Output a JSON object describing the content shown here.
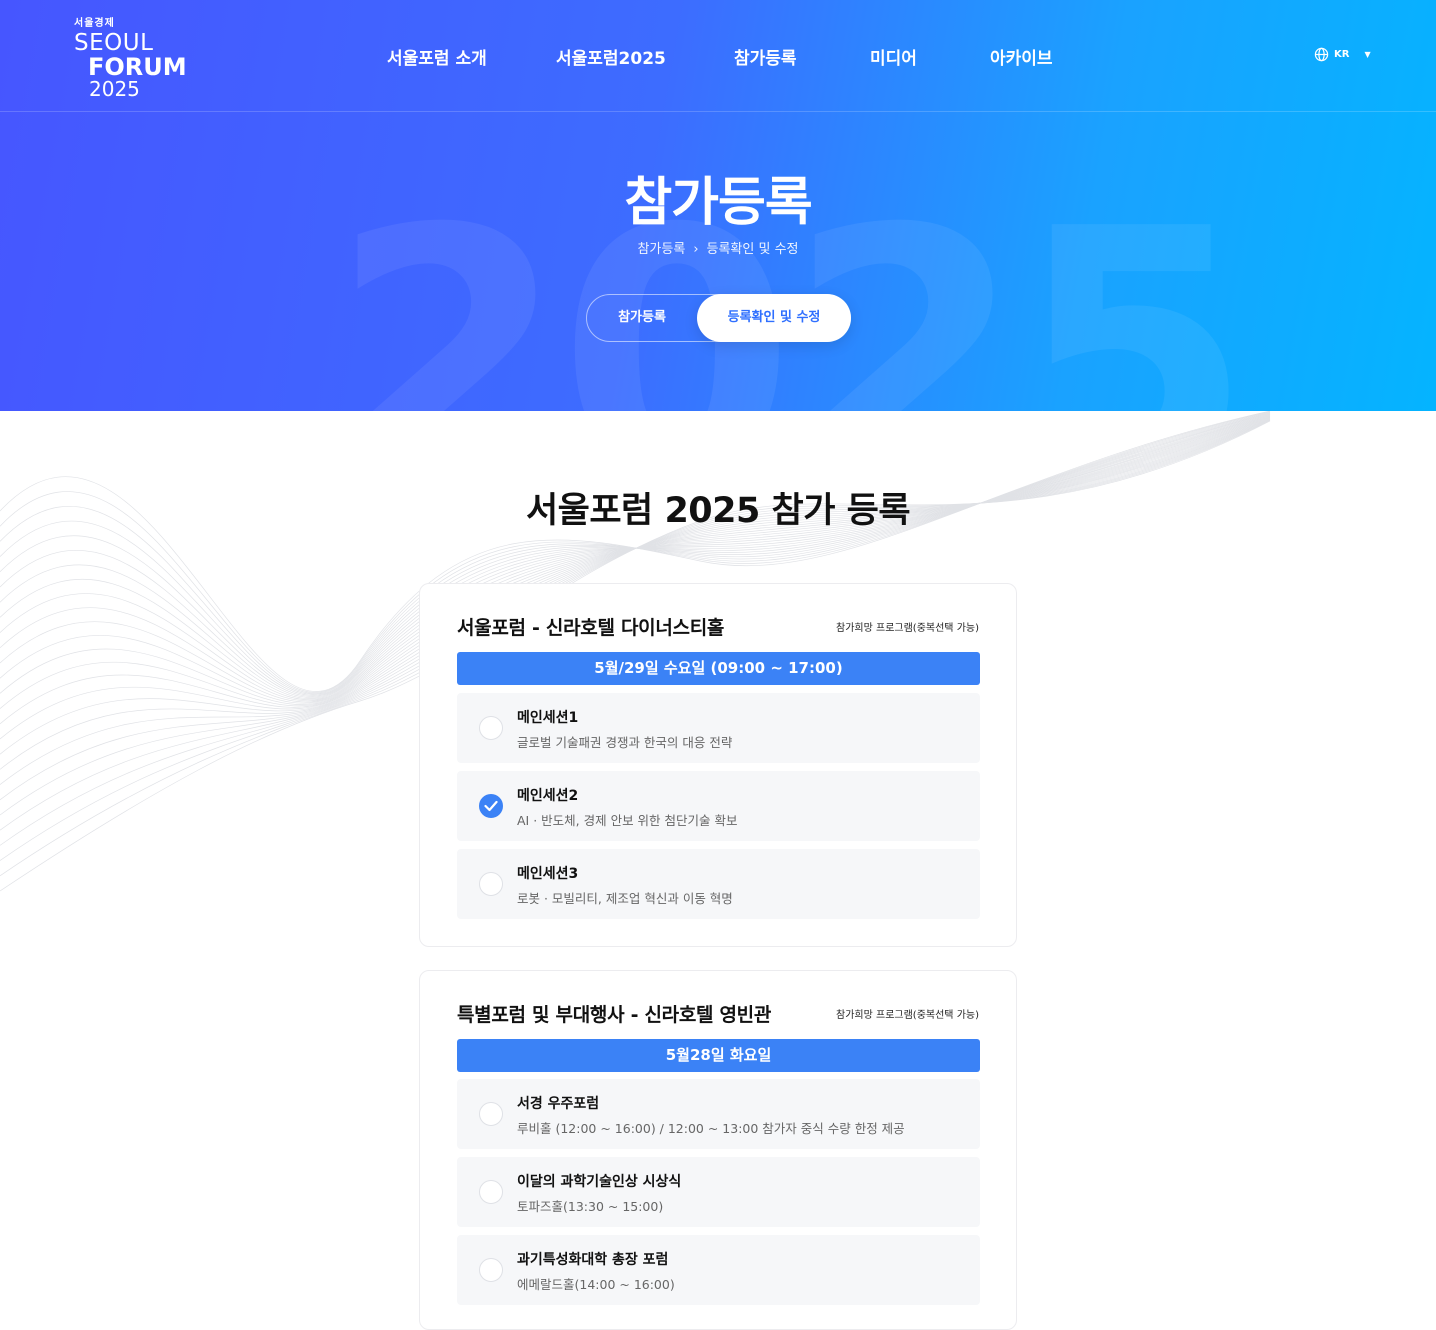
{
  "logo": {
    "korean": "서울경제",
    "line1": "SEOUL",
    "line2": "FORUM",
    "line3": "2025"
  },
  "nav": [
    "서울포럼 소개",
    "서울포럼2025",
    "참가등록",
    "미디어",
    "아카이브"
  ],
  "lang": {
    "label": "KR",
    "icon": "globe-icon"
  },
  "hero": {
    "title": "참가등록",
    "bg_number": "2025",
    "breadcrumb": [
      "참가등록",
      "등록확인 및 수정"
    ],
    "tabs": [
      "참가등록",
      "등록확인 및 수정"
    ],
    "active_tab": 1
  },
  "section_title": "서울포럼 2025 참가 등록",
  "cards": [
    {
      "title": "서울포럼 - 신라호텔 다이너스티홀",
      "note": "참가희망 프로그램(중복선택 가능)",
      "date": "5월/29일 수요일 (09:00 ~ 17:00)",
      "options": [
        {
          "title": "메인세션1",
          "sub": "글로벌 기술패권 경쟁과 한국의 대응 전략",
          "checked": false
        },
        {
          "title": "메인세션2",
          "sub": "AI · 반도체, 경제 안보 위한 첨단기술 확보",
          "checked": true
        },
        {
          "title": "메인세션3",
          "sub": "로봇 · 모빌리티, 제조업 혁신과 이동 혁명",
          "checked": false
        }
      ]
    },
    {
      "title": "특별포럼 및 부대행사 - 신라호텔 영빈관",
      "note": "참가희망 프로그램(중복선택 가능)",
      "date": "5월28일 화요일",
      "options": [
        {
          "title": "서경 우주포럼",
          "sub": "루비홀 (12:00 ~ 16:00) / 12:00 ~ 13:00 참가자 중식 수량 한정 제공",
          "checked": false
        },
        {
          "title": "이달의 과학기술인상 시상식",
          "sub": "토파즈홀(13:30 ~ 15:00)",
          "checked": false
        },
        {
          "title": "과기특성화대학 총장 포럼",
          "sub": "에메랄드홀(14:00 ~ 16:00)",
          "checked": false
        }
      ]
    }
  ]
}
